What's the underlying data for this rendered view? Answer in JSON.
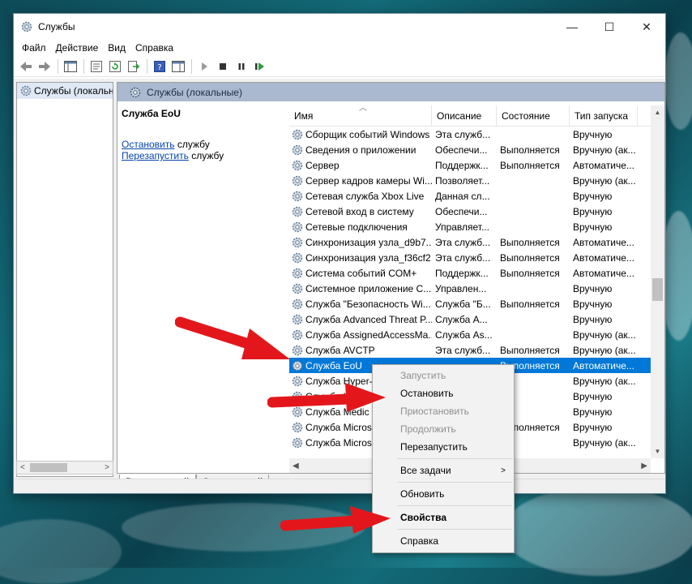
{
  "window": {
    "title": "Службы",
    "controls": {
      "minimize": "—",
      "maximize": "☐",
      "close": "✕"
    }
  },
  "menu": [
    "Файл",
    "Действие",
    "Вид",
    "Справка"
  ],
  "tree": {
    "item": "Службы (локальны",
    "scroll_left": "<",
    "scroll_right": ">"
  },
  "main": {
    "header": "Службы (локальные)",
    "description": {
      "title": "Служба EoU",
      "stop_link": "Остановить",
      "stop_suffix": " службу",
      "restart_link": "Перезапустить",
      "restart_suffix": " службу"
    },
    "columns": {
      "name": "Имя",
      "desc": "Описание",
      "state": "Состояние",
      "startup": "Тип запуска"
    },
    "rows": [
      {
        "name": "Сборщик событий Windows",
        "desc": "Эта служб...",
        "state": "",
        "startup": "Вручную"
      },
      {
        "name": "Сведения о приложении",
        "desc": "Обеспечи...",
        "state": "Выполняется",
        "startup": "Вручную (ак..."
      },
      {
        "name": "Сервер",
        "desc": "Поддержк...",
        "state": "Выполняется",
        "startup": "Автоматиче..."
      },
      {
        "name": "Сервер кадров камеры Wi...",
        "desc": "Позволяет...",
        "state": "",
        "startup": "Вручную (ак..."
      },
      {
        "name": "Сетевая служба Xbox Live",
        "desc": "Данная сл...",
        "state": "",
        "startup": "Вручную"
      },
      {
        "name": "Сетевой вход в систему",
        "desc": "Обеспечи...",
        "state": "",
        "startup": "Вручную"
      },
      {
        "name": "Сетевые подключения",
        "desc": "Управляет...",
        "state": "",
        "startup": "Вручную"
      },
      {
        "name": "Синхронизация узла_d9b7...",
        "desc": "Эта служб...",
        "state": "Выполняется",
        "startup": "Автоматиче..."
      },
      {
        "name": "Синхронизация узла_f36cf2",
        "desc": "Эта служб...",
        "state": "Выполняется",
        "startup": "Автоматиче..."
      },
      {
        "name": "Система событий COM+",
        "desc": "Поддержк...",
        "state": "Выполняется",
        "startup": "Автоматиче..."
      },
      {
        "name": "Системное приложение С...",
        "desc": "Управлен...",
        "state": "",
        "startup": "Вручную"
      },
      {
        "name": "Служба \"Безопасность Wi...",
        "desc": "Служба \"Б...",
        "state": "Выполняется",
        "startup": "Вручную"
      },
      {
        "name": "Служба Advanced Threat P...",
        "desc": "Служба А...",
        "state": "",
        "startup": "Вручную"
      },
      {
        "name": "Служба AssignedAccessMa...",
        "desc": "Служба As...",
        "state": "",
        "startup": "Вручную (ак..."
      },
      {
        "name": "Служба AVCTP",
        "desc": "Эта служб...",
        "state": "Выполняется",
        "startup": "Вручную (ак..."
      },
      {
        "name": "Служба EoU",
        "desc": "",
        "state": "Выполняется",
        "startup": "Автоматиче..."
      },
      {
        "name": "Служба Hyper-",
        "desc": "",
        "state": "",
        "startup": "Вручную (ак..."
      },
      {
        "name": "Служба Lan",
        "desc": "",
        "state": "",
        "startup": "Вручную"
      },
      {
        "name": "Служба Medic",
        "desc": "",
        "state": "",
        "startup": "Вручную"
      },
      {
        "name": "Служба Micros",
        "desc": "",
        "state": "Выполняется",
        "startup": "Вручную"
      },
      {
        "name": "Служба Micros",
        "desc": "",
        "state": "",
        "startup": "Вручную (ак..."
      }
    ],
    "selected_index": 15
  },
  "tabs": [
    "Расширенный",
    "Стандартный"
  ],
  "context_menu": {
    "items": [
      {
        "label": "Запустить",
        "disabled": true
      },
      {
        "label": "Остановить",
        "disabled": false
      },
      {
        "label": "Приостановить",
        "disabled": true
      },
      {
        "label": "Продолжить",
        "disabled": true
      },
      {
        "label": "Перезапустить",
        "disabled": false
      },
      {
        "sep": true
      },
      {
        "label": "Все задачи",
        "disabled": false,
        "submenu": true
      },
      {
        "sep": true
      },
      {
        "label": "Обновить",
        "disabled": false
      },
      {
        "sep": true
      },
      {
        "label": "Свойства",
        "disabled": false,
        "bold": true
      },
      {
        "sep": true
      },
      {
        "label": "Справка",
        "disabled": false
      }
    ]
  },
  "colors": {
    "selection": "#0078d7",
    "header": "#aab9cf",
    "arrow": "#e3171b"
  }
}
